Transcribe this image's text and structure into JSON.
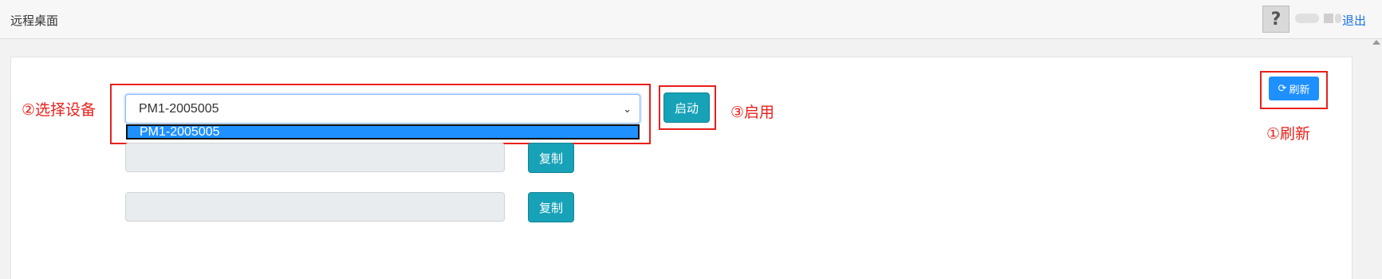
{
  "header": {
    "title": "远程桌面",
    "logout_label": "退出"
  },
  "device_select": {
    "selected": "PM1-2005005",
    "options": [
      "PM1-2005005"
    ]
  },
  "buttons": {
    "start_label": "启动",
    "copy_label": "复制",
    "refresh_label": "刷新"
  },
  "annotations": {
    "select_device": "②选择设备",
    "enable": "③启用",
    "refresh": "①刷新"
  },
  "colors": {
    "annotation_red": "#e8201a",
    "teal_button": "#17a2b8",
    "refresh_blue": "#1e90ff"
  }
}
